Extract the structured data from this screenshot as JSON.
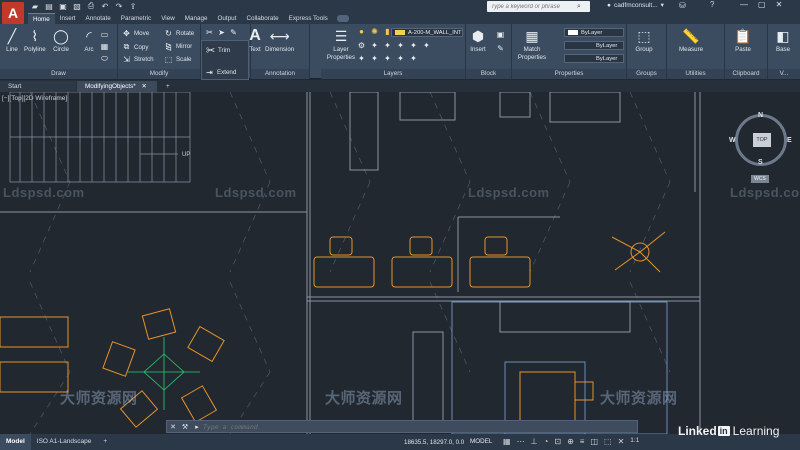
{
  "app": {
    "logo_letter": "A"
  },
  "quick_access": {
    "icons": [
      "folder-icon",
      "open-icon",
      "save-icon",
      "save-as-icon",
      "print-icon",
      "undo-icon",
      "redo-icon",
      "share-icon"
    ]
  },
  "search": {
    "placeholder": "Type a keyword or phrase"
  },
  "user": {
    "name": "cadfmconsult..."
  },
  "window_controls": {
    "minimize": "—",
    "restore": "▢",
    "close": "✕"
  },
  "ribbon_tabs": [
    "Home",
    "Insert",
    "Annotate",
    "Parametric",
    "View",
    "Manage",
    "Output",
    "Collaborate",
    "Express Tools"
  ],
  "ribbon": {
    "draw": {
      "label": "Draw",
      "tools": [
        "Line",
        "Polyline",
        "Circle",
        "Arc"
      ]
    },
    "modify": {
      "label": "Modify",
      "tools": [
        "Move",
        "Copy",
        "Stretch",
        "Rotate",
        "Mirror",
        "Scale"
      ]
    },
    "trim_popup": {
      "trim": "Trim",
      "extend": "Extend"
    },
    "annotation": {
      "label": "Annotation",
      "text": "Text",
      "dimension": "Dimension"
    },
    "layers": {
      "label": "Layers",
      "properties": "Layer Properties",
      "current_layer": "A-200-M_WALL_INT"
    },
    "block": {
      "label": "Block",
      "insert": "Insert"
    },
    "properties": {
      "label": "Properties",
      "match": "Match Properties",
      "color": "ByLayer",
      "linetype": "ByLayer",
      "lineweight": "ByLayer"
    },
    "groups": {
      "label": "Groups",
      "group": "Group"
    },
    "utilities": {
      "label": "Utilities",
      "measure": "Measure"
    },
    "clipboard": {
      "label": "Clipboard",
      "paste": "Paste"
    },
    "view": {
      "label": "V...",
      "base": "Base"
    }
  },
  "file_tabs": {
    "start": "Start",
    "active": "ModifyingObjects*",
    "add": "+"
  },
  "viewport": {
    "label": "[−][Top][2D Wireframe]"
  },
  "drawing": {
    "stair_label": "UP"
  },
  "viewcube": {
    "top": "TOP",
    "north": "N",
    "south": "S",
    "east": "E",
    "west": "W",
    "wcs": "WCS"
  },
  "watermarks": [
    "Ldspsd.com",
    "Ldspsd.com",
    "Ldspsd.com",
    "Ldspsd.com",
    "Ldspsd.com",
    "大师资源网",
    "大师资源网",
    "大师资源网",
    "大师资源网"
  ],
  "command": {
    "placeholder": "Type a command"
  },
  "status": {
    "layout_tabs": [
      "Model",
      "ISO A1-Landscape"
    ],
    "add": "+",
    "coords": "18635.5, 18297.0, 0.0",
    "model": "MODEL",
    "scale": "1:1"
  },
  "brand": {
    "linked": "Linked",
    "in": "in",
    "learning": "Learning"
  },
  "colors": {
    "accent": "#e8922a",
    "ribbon": "#3b4b60",
    "canvas": "#212830"
  }
}
